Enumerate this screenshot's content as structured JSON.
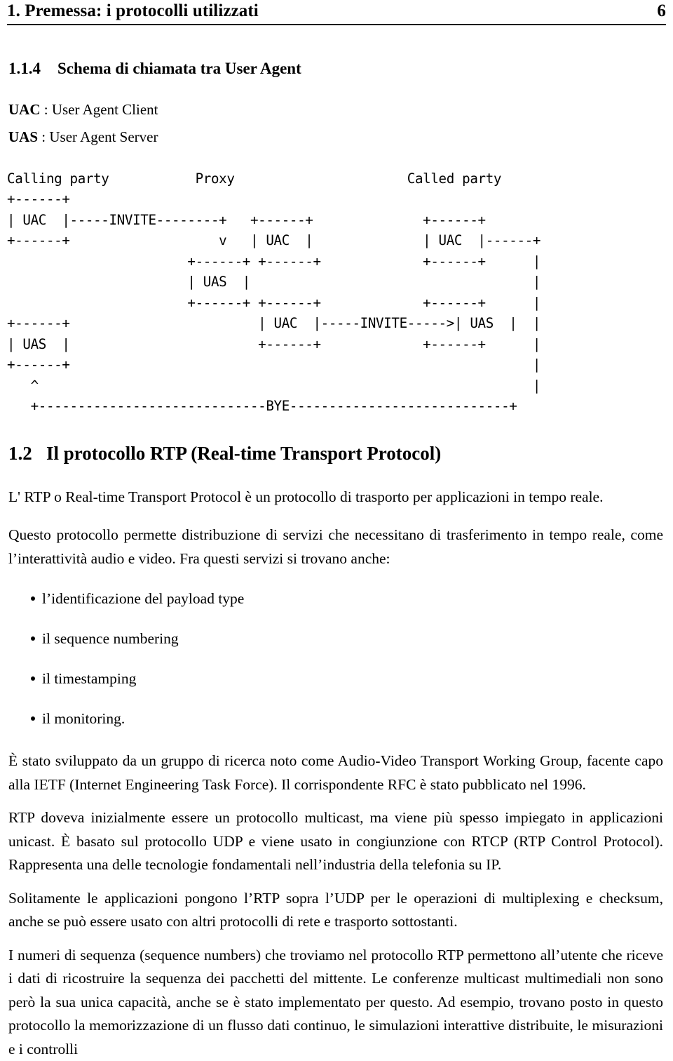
{
  "header": {
    "title": "1. Premessa: i protocolli utilizzati",
    "page_number": "6"
  },
  "subsection": {
    "number": "1.1.4",
    "title": "Schema di chiamata tra User Agent"
  },
  "definitions": [
    {
      "term": "UAC",
      "separator": " : ",
      "expansion": "User Agent Client"
    },
    {
      "term": "UAS",
      "separator": " : ",
      "expansion": "User Agent Server"
    }
  ],
  "diagram": {
    "name": "sip-call-flow-ascii-diagram",
    "labels": [
      "Calling party",
      "Proxy",
      "Called party"
    ],
    "messages": [
      "INVITE",
      "INVITE",
      "BYE"
    ],
    "nodes": [
      "UAC",
      "UAC",
      "UAS",
      "UAC",
      "UAS",
      "UAS",
      "UAC"
    ],
    "text": "Calling party           Proxy                      Called party\n+------+\n| UAC  |-----INVITE--------+   +------+              +------+\n+------+                   v   | UAC  |              | UAC  |------+\n                       +------+ +------+             +------+      |\n                       | UAS  |                                    |\n                       +------+ +------+             +------+      |\n+------+                        | UAC  |-----INVITE----->| UAS  |  |\n| UAS  |                        +------+             +------+      |\n+------+                                                           |\n   ^                                                               |\n   +-----------------------------BYE----------------------------+"
  },
  "section": {
    "number": "1.2",
    "title": "Il protocollo RTP (Real-time Transport Protocol)"
  },
  "paragraphs": {
    "intro": "L' RTP o Real-time Transport Protocol è un protocollo di trasporto per applicazioni in tempo reale.",
    "services_lead": "Questo protocollo permette distribuzione di servizi che necessitano di trasferimento in tempo reale, come l’interattività audio e video. Fra questi servizi si trovano anche:",
    "history": "È stato sviluppato da un gruppo di ricerca noto come Audio-Video Transport Working Group, facente capo alla IETF (Internet Engineering Task Force). Il corrispondente RFC è stato pubblicato nel 1996.",
    "multicast": "RTP doveva inizialmente essere un protocollo multicast, ma viene più spesso impiegato in applicazioni unicast. È basato sul protocollo UDP e viene usato in congiunzione con RTCP (RTP Control Protocol). Rappresenta una delle tecnologie fondamentali nell’industria della telefonia su IP.",
    "udp": "Solitamente le applicazioni pongono l’RTP sopra l’UDP per le operazioni di multiplexing e checksum, anche se può essere usato con altri protocolli di rete e trasporto sottostanti.",
    "sequence": "I numeri di sequenza (sequence numbers) che troviamo nel protocollo RTP permettono all’utente che riceve i dati di ricostruire la sequenza dei pacchetti del mittente. Le conferenze multicast multimediali non sono però la sua unica capacità, anche se è stato implementato per questo. Ad esempio, trovano posto in questo protocollo la memorizzazione di un flusso dati continuo, le simulazioni interattive distribuite, le misurazioni e i controlli"
  },
  "bullets": [
    "l’identificazione del payload type",
    "il sequence numbering",
    "il timestamping",
    "il monitoring."
  ]
}
